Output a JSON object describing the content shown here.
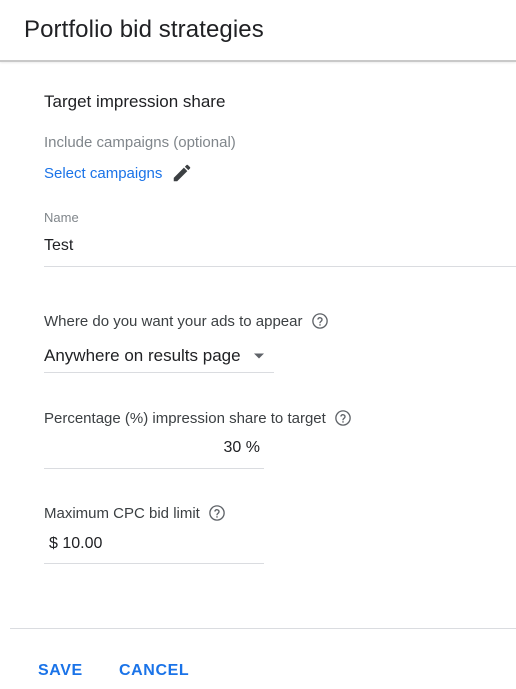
{
  "header": {
    "title": "Portfolio bid strategies"
  },
  "strategy": {
    "title": "Target impression share"
  },
  "campaigns": {
    "label": "Include campaigns (optional)",
    "link": "Select campaigns",
    "edit_icon": "pencil-icon"
  },
  "name_field": {
    "label": "Name",
    "value": "Test"
  },
  "appear": {
    "label": "Where do you want your ads to appear",
    "help_icon": "help-circle-icon",
    "selected": "Anywhere on results page",
    "caret_icon": "caret-down-icon"
  },
  "percentage": {
    "label": "Percentage (%) impression share to target",
    "help_icon": "help-circle-icon",
    "value": "30 %"
  },
  "max_cpc": {
    "label": "Maximum CPC bid limit",
    "help_icon": "help-circle-icon",
    "value": "$ 10.00"
  },
  "actions": {
    "save": "SAVE",
    "cancel": "CANCEL"
  },
  "colors": {
    "accent": "#1a73e8",
    "secondary_text": "#80868b",
    "divider": "#dadce0"
  }
}
